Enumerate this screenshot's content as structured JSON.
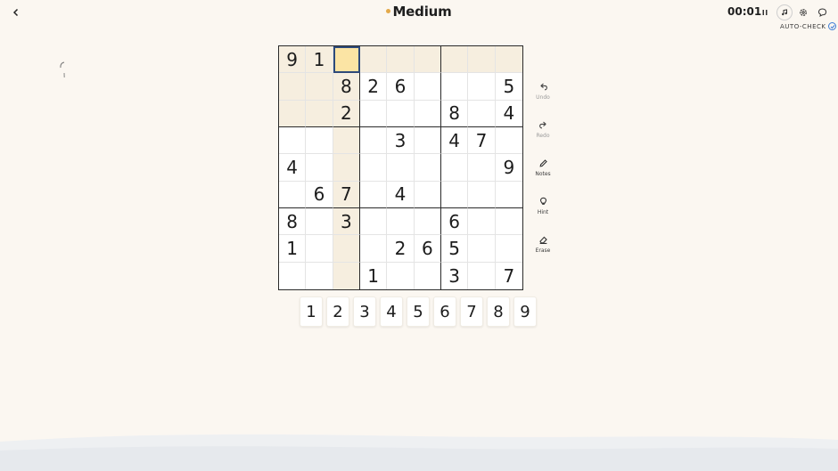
{
  "header": {
    "title": "Medium",
    "timer": "00:01",
    "auto_check_label": "AUTO-CHECK"
  },
  "board": {
    "rows": [
      [
        "9",
        "1",
        "",
        "",
        "",
        "",
        "",
        "",
        ""
      ],
      [
        "",
        "",
        "8",
        "2",
        "6",
        "",
        "",
        "",
        "5"
      ],
      [
        "",
        "",
        "2",
        "",
        "",
        "",
        "8",
        "",
        "4"
      ],
      [
        "",
        "",
        "",
        "",
        "3",
        "",
        "4",
        "7",
        ""
      ],
      [
        "4",
        "",
        "",
        "",
        "",
        "",
        "",
        "",
        "9"
      ],
      [
        "",
        "6",
        "7",
        "",
        "4",
        "",
        "",
        "",
        ""
      ],
      [
        "8",
        "",
        "3",
        "",
        "",
        "",
        "6",
        "",
        ""
      ],
      [
        "1",
        "",
        "",
        "",
        "2",
        "6",
        "5",
        "",
        ""
      ],
      [
        "",
        "",
        "",
        "1",
        "",
        "",
        "3",
        "",
        "7"
      ]
    ],
    "selected": {
      "row": 0,
      "col": 2
    }
  },
  "tools": [
    {
      "name": "undo",
      "label": "Undo",
      "icon": "undo-icon",
      "active": false
    },
    {
      "name": "redo",
      "label": "Redo",
      "icon": "redo-icon",
      "active": false
    },
    {
      "name": "notes",
      "label": "Notes",
      "icon": "pencil-icon",
      "active": true
    },
    {
      "name": "hint",
      "label": "Hint",
      "icon": "lightbulb-icon",
      "active": true
    },
    {
      "name": "erase",
      "label": "Erase",
      "icon": "eraser-icon",
      "active": true
    }
  ],
  "numpad": [
    "1",
    "2",
    "3",
    "4",
    "5",
    "6",
    "7",
    "8",
    "9"
  ],
  "colors": {
    "background": "#fbf7f1",
    "highlight": "#f6eedf",
    "selected": "#fbe4a4",
    "accent_dot": "#e3a94a",
    "check_blue": "#3b7bd6"
  }
}
